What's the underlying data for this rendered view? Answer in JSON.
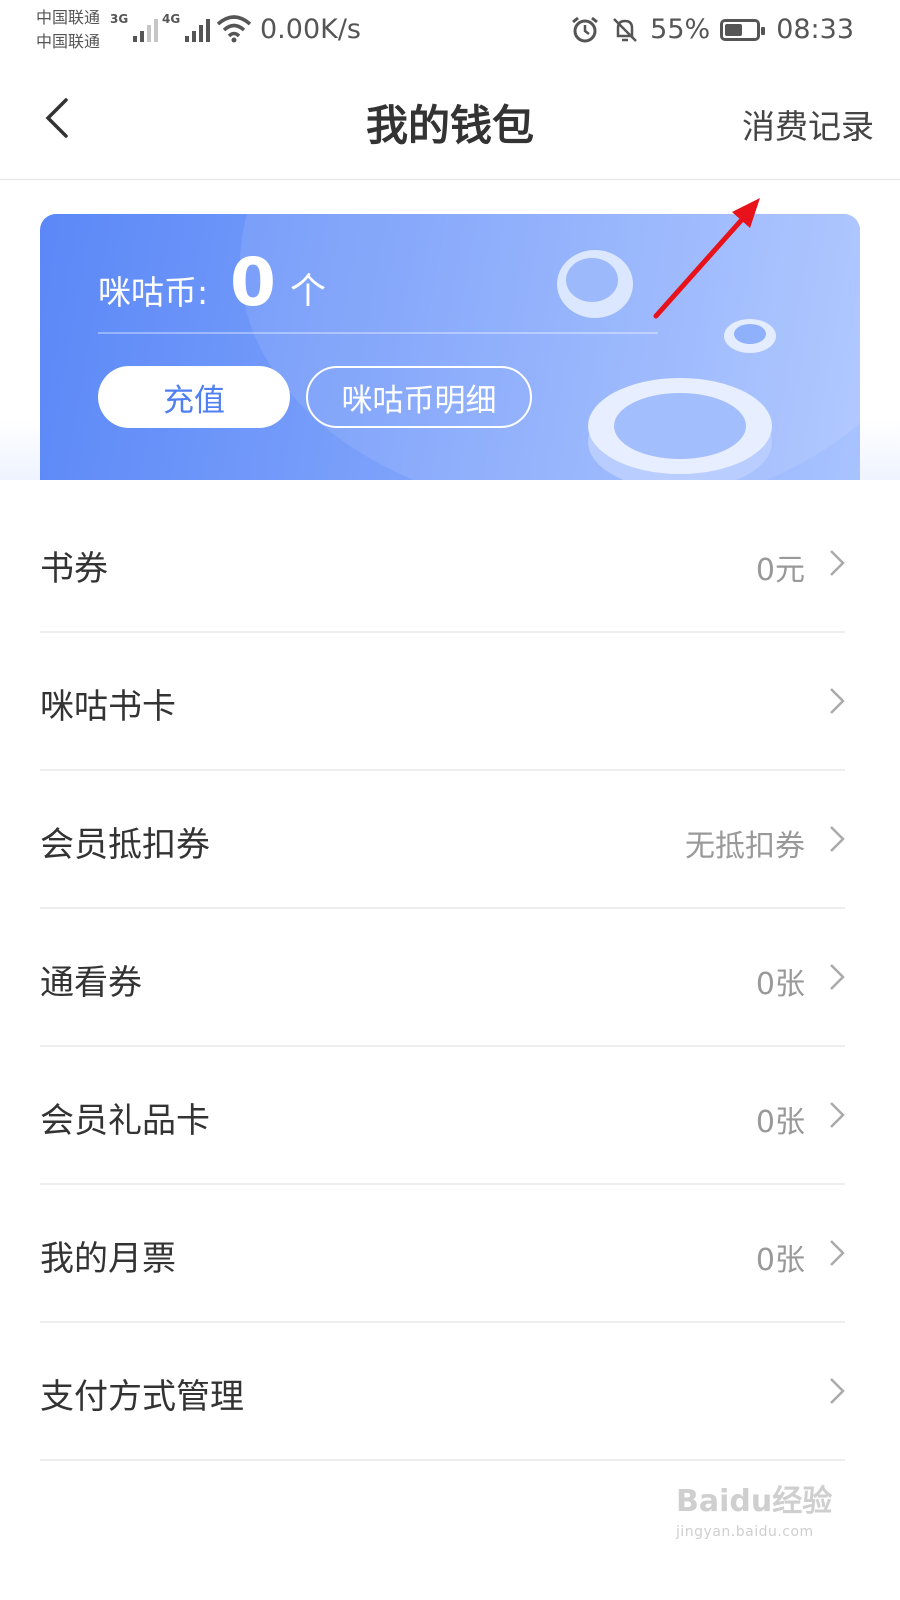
{
  "status_bar": {
    "carrier_1": "中国联通",
    "carrier_2": "中国联通",
    "sim1_tech": "3G",
    "sim2_tech": "4G",
    "net_speed": "0.00K/s",
    "battery": "55%",
    "battery_level": 0.55,
    "time": "08:33",
    "icons": [
      "alarm-icon",
      "mute-icon",
      "wifi-icon",
      "signal-icon",
      "battery-icon"
    ]
  },
  "header": {
    "title": "我的钱包",
    "right_link": "消费记录"
  },
  "card": {
    "coin_label": "咪咕币:",
    "coin_value": "0",
    "coin_unit": "个",
    "recharge_button": "充值",
    "detail_button": "咪咕币明细"
  },
  "list": {
    "items": [
      {
        "label": "书券",
        "value": "0元"
      },
      {
        "label": "咪咕书卡",
        "value": ""
      },
      {
        "label": "会员抵扣券",
        "value": "无抵扣券"
      },
      {
        "label": "通看券",
        "value": "0张"
      },
      {
        "label": "会员礼品卡",
        "value": "0张"
      },
      {
        "label": "我的月票",
        "value": "0张"
      },
      {
        "label": "支付方式管理",
        "value": ""
      }
    ]
  },
  "watermark": {
    "text": "Baidu经验",
    "url": "jingyan.baidu.com"
  },
  "colors": {
    "card_start": "#5b88f7",
    "card_end": "#a9c3ff",
    "accent": "#4f7ff2",
    "annotation_arrow": "#e8121b"
  }
}
